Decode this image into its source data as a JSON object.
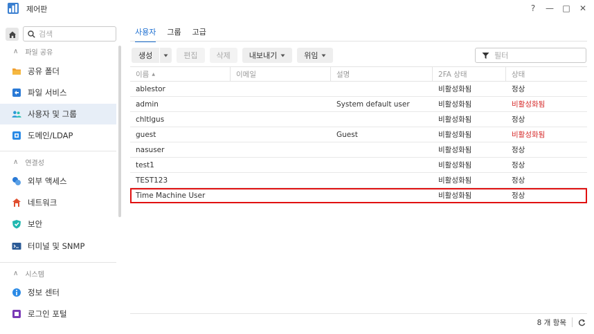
{
  "window": {
    "title": "제어판",
    "controls": [
      "?",
      "—",
      "□",
      "✕"
    ]
  },
  "sidebar": {
    "search_placeholder": "검색",
    "sections": [
      {
        "label": "파일 공유",
        "items": [
          {
            "label": "공유 폴더",
            "icon": "folder-icon",
            "color": "#f0a030"
          },
          {
            "label": "파일 서비스",
            "icon": "file-service-icon",
            "color": "#2a7ad6"
          },
          {
            "label": "사용자 및 그룹",
            "icon": "users-icon",
            "color": "#2a9ad6",
            "active": true
          },
          {
            "label": "도메인/LDAP",
            "icon": "domain-icon",
            "color": "#2a8ae6"
          }
        ]
      },
      {
        "label": "연결성",
        "items": [
          {
            "label": "외부 액세스",
            "icon": "external-access-icon",
            "color": "#2a7ad6"
          },
          {
            "label": "네트워크",
            "icon": "network-icon",
            "color": "#e05030"
          },
          {
            "label": "보안",
            "icon": "security-shield-icon",
            "color": "#20b8b0"
          },
          {
            "label": "터미널 및 SNMP",
            "icon": "terminal-icon",
            "color": "#2a5a96"
          }
        ]
      },
      {
        "label": "시스템",
        "items": [
          {
            "label": "정보 센터",
            "icon": "info-icon",
            "color": "#2a8ae6"
          },
          {
            "label": "로그인 포털",
            "icon": "login-portal-icon",
            "color": "#7a3ab6"
          }
        ]
      }
    ]
  },
  "tabs": [
    {
      "label": "사용자",
      "active": true
    },
    {
      "label": "그룹",
      "active": false
    },
    {
      "label": "고급",
      "active": false
    }
  ],
  "toolbar": {
    "create": "생성",
    "edit": "편집",
    "delete": "삭제",
    "export": "내보내기",
    "delegate": "위임",
    "filter_placeholder": "필터"
  },
  "table": {
    "columns": [
      "이름",
      "이메일",
      "설명",
      "2FA 상태",
      "상태"
    ],
    "sort_indicator": "▲",
    "rows": [
      {
        "name": "ablestor",
        "email": "",
        "description": "",
        "twofa": "비활성화됨",
        "status": "정상",
        "status_red": false
      },
      {
        "name": "admin",
        "email": "",
        "description": "System default user",
        "twofa": "비활성화됨",
        "status": "비활성화됨",
        "status_red": true
      },
      {
        "name": "chltlgus",
        "email": "",
        "description": "",
        "twofa": "비활성화됨",
        "status": "정상",
        "status_red": false
      },
      {
        "name": "guest",
        "email": "",
        "description": "Guest",
        "twofa": "비활성화됨",
        "status": "비활성화됨",
        "status_red": true
      },
      {
        "name": "nasuser",
        "email": "",
        "description": "",
        "twofa": "비활성화됨",
        "status": "정상",
        "status_red": false
      },
      {
        "name": "test1",
        "email": "",
        "description": "",
        "twofa": "비활성화됨",
        "status": "정상",
        "status_red": false
      },
      {
        "name": "TEST123",
        "email": "",
        "description": "",
        "twofa": "비활성화됨",
        "status": "정상",
        "status_red": false
      },
      {
        "name": "Time Machine User",
        "email": "",
        "description": "",
        "twofa": "비활성화됨",
        "status": "정상",
        "status_red": false,
        "highlighted": true
      }
    ]
  },
  "footer": {
    "count": "8 개 항목"
  },
  "colors": {
    "accent": "#1a6dd0",
    "disabled_red": "#d62b2b",
    "highlight_border": "#e01010",
    "active_sidebar": "#e7eef7"
  }
}
